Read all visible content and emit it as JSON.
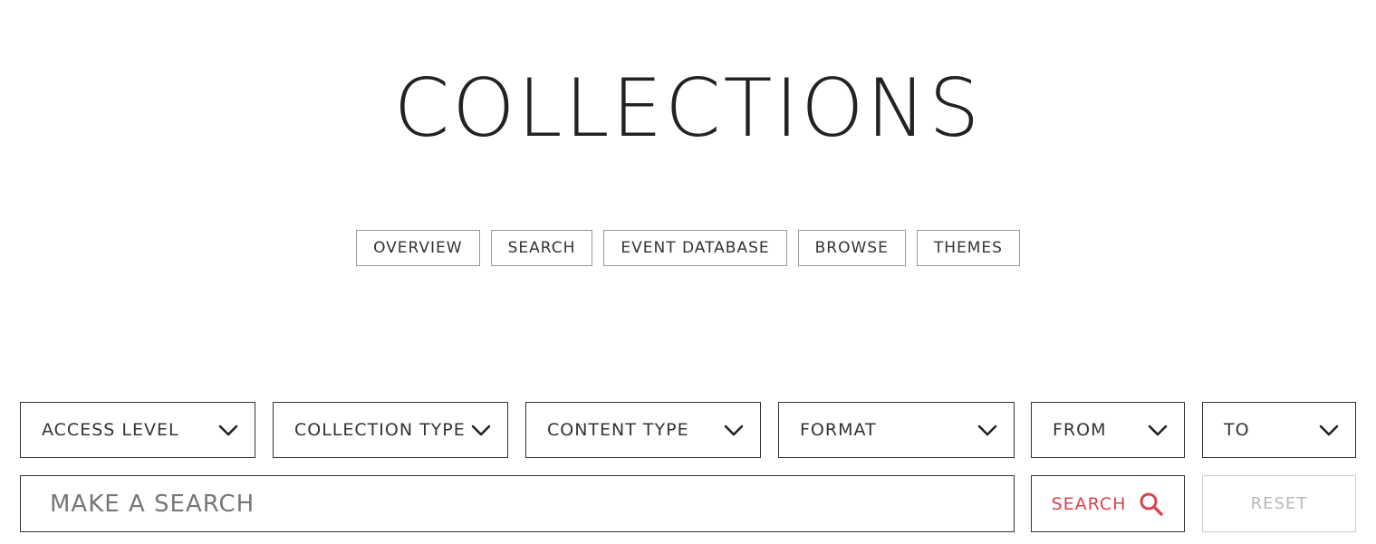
{
  "header": {
    "title": "COLLECTIONS"
  },
  "nav": {
    "items": [
      {
        "label": "OVERVIEW"
      },
      {
        "label": "SEARCH"
      },
      {
        "label": "EVENT DATABASE"
      },
      {
        "label": "BROWSE"
      },
      {
        "label": "THEMES"
      }
    ]
  },
  "filters": {
    "access_level": "ACCESS LEVEL",
    "collection_type": "COLLECTION TYPE",
    "content_type": "CONTENT TYPE",
    "format": "FORMAT",
    "from": "FROM",
    "to": "TO",
    "chevron_icon": "chevron-down-icon"
  },
  "search": {
    "placeholder": "MAKE A SEARCH",
    "value": "",
    "button_label": "SEARCH",
    "button_icon": "magnifier-icon",
    "reset_label": "RESET"
  },
  "colors": {
    "text": "#222222",
    "accent": "#d9434b",
    "disabled": "#b8b8b8",
    "border": "#333333"
  }
}
